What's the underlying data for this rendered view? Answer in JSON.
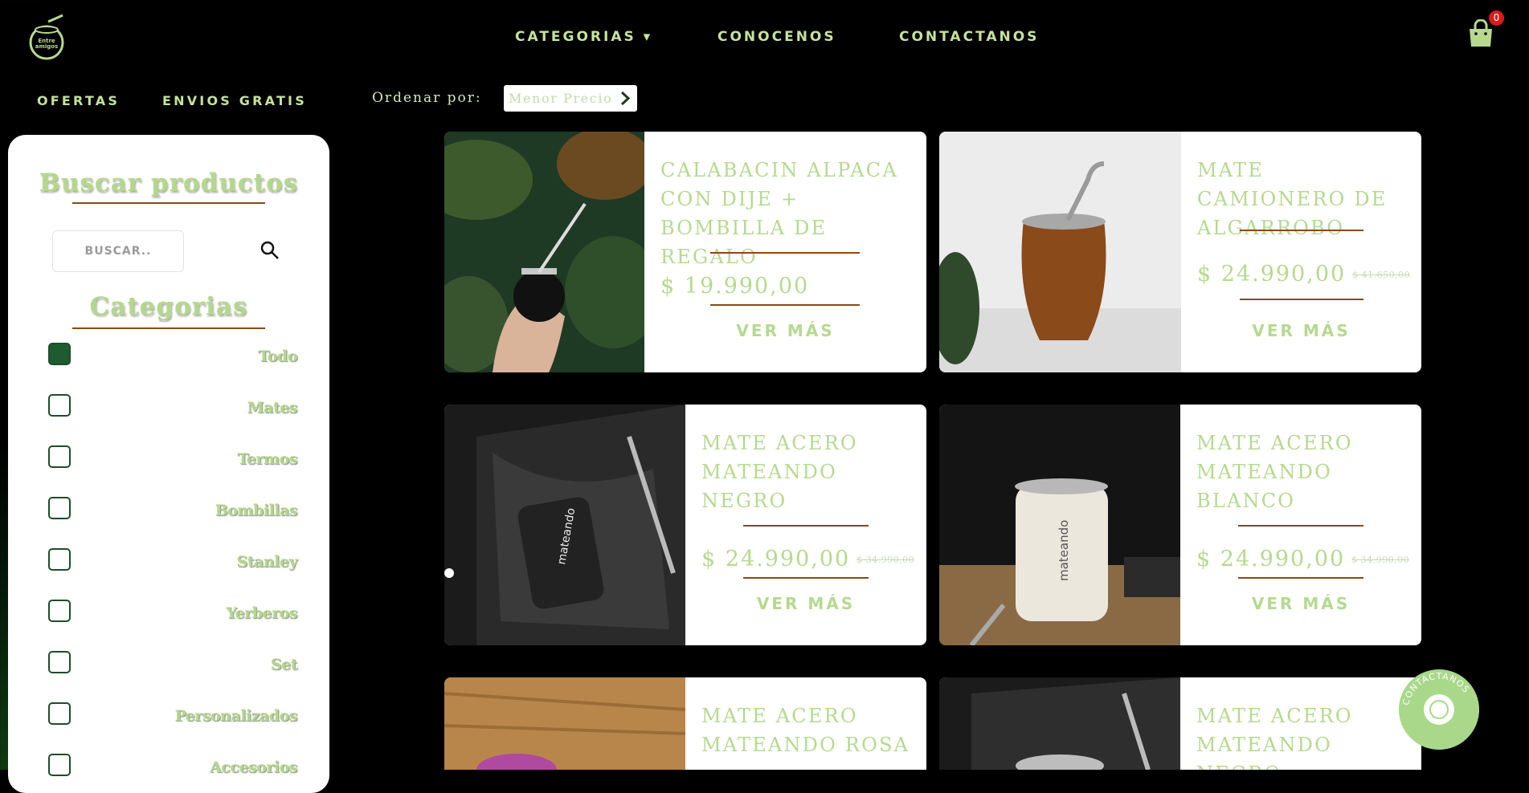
{
  "brand": {
    "logo_text": "Entre amigos"
  },
  "nav": {
    "categorias": "CATEGORIAS ▾",
    "conocenos": "CONOCENOS",
    "contactanos": "CONTACTANOS"
  },
  "cart": {
    "count": "0"
  },
  "subnav": {
    "ofertas": "OFERTAS",
    "envios": "ENVIOS GRATIS"
  },
  "sort": {
    "label": "Ordenar por:",
    "value": "Menor Precio"
  },
  "sidebar": {
    "search_title": "Buscar productos",
    "search_placeholder": "BUSCAR..",
    "categories_title": "Categorias",
    "categories": [
      {
        "label": "Todo",
        "checked": true
      },
      {
        "label": "Mates",
        "checked": false
      },
      {
        "label": "Termos",
        "checked": false
      },
      {
        "label": "Bombillas",
        "checked": false
      },
      {
        "label": "Stanley",
        "checked": false
      },
      {
        "label": "Yerberos",
        "checked": false
      },
      {
        "label": "Set",
        "checked": false
      },
      {
        "label": "Personalizados",
        "checked": false
      },
      {
        "label": "Accesorios",
        "checked": false
      }
    ]
  },
  "products": [
    {
      "name": "CALABACIN ALPACA CON DIJE + BOMBILLA DE REGALO",
      "price": "$ 19.990,00",
      "old_price": "",
      "more": "VER MÁS"
    },
    {
      "name": "MATE CAMIONERO DE ALGARROBO",
      "price": "$ 24.990,00",
      "old_price": "$ 41.650,00",
      "more": "VER MÁS"
    },
    {
      "name": "MATE ACERO MATEANDO NEGRO",
      "price": "$ 24.990,00",
      "old_price": "$ 34.990,00",
      "more": "VER MÁS"
    },
    {
      "name": "MATE ACERO MATEANDO BLANCO",
      "price": "$ 24.990,00",
      "old_price": "$ 34.990,00",
      "more": "VER MÁS"
    },
    {
      "name": "MATE ACERO MATEANDO ROSA",
      "price": "",
      "old_price": "",
      "more": ""
    },
    {
      "name": "MATE ACERO MATEANDO NEGRO",
      "price": "",
      "old_price": "",
      "more": ""
    }
  ],
  "fab": {
    "label": "CONTACTANOS"
  },
  "colors": {
    "accent_green": "#b6d98f",
    "rule_brown": "#8a4a12",
    "badge_red": "#d81b1b"
  }
}
